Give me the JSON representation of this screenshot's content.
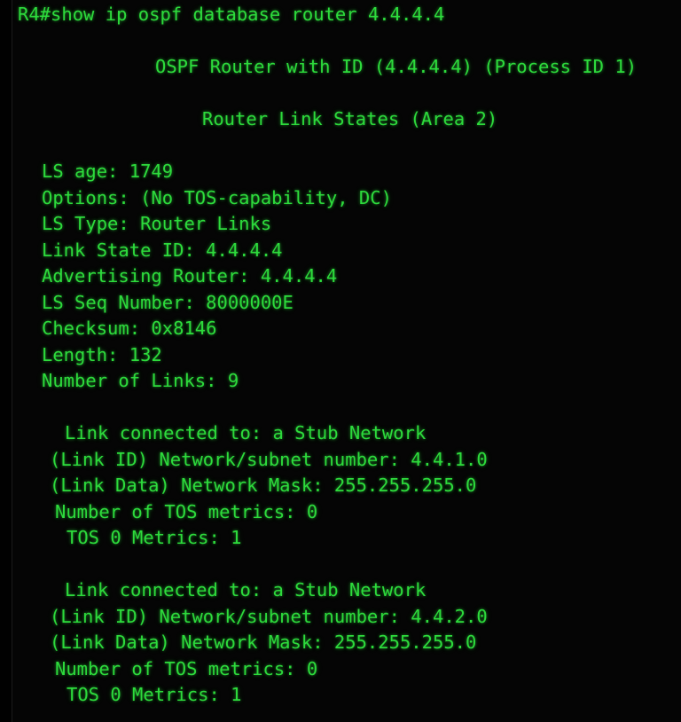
{
  "terminal": {
    "background_color": "#050505",
    "text_color": "#2ddb3c",
    "bezel_color": "#1b1b1b",
    "prompt": "R4#",
    "command": "show ip ospf database router 4.4.4.4",
    "prompt_line": "R4#show ip ospf database router 4.4.4.4"
  },
  "output": {
    "header_process": "OSPF Router with ID (4.4.4.4) (Process ID 1)",
    "header_area": "Router Link States (Area 2)",
    "lsa": {
      "ls_age": "LS age: 1749",
      "options": "Options: (No TOS-capability, DC)",
      "ls_type": "LS Type: Router Links",
      "link_state_id": "Link State ID: 4.4.4.4",
      "advertising_router": "Advertising Router: 4.4.4.4",
      "ls_seq_number": "LS Seq Number: 8000000E",
      "checksum": "Checksum: 0x8146",
      "length": "Length: 132",
      "number_of_links": "Number of Links: 9"
    },
    "links": [
      {
        "connected_to": "Link connected to: a Stub Network",
        "link_id": "(Link ID) Network/subnet number: 4.4.1.0",
        "link_data": "(Link Data) Network Mask: 255.255.255.0",
        "tos_metrics_count": "Number of TOS metrics: 0",
        "tos_0_metrics": "TOS 0 Metrics: 1"
      },
      {
        "connected_to": "Link connected to: a Stub Network",
        "link_id": "(Link ID) Network/subnet number: 4.4.2.0",
        "link_data": "(Link Data) Network Mask: 255.255.255.0",
        "tos_metrics_count": "Number of TOS metrics: 0",
        "tos_0_metrics": "TOS 0 Metrics: 1"
      }
    ]
  }
}
